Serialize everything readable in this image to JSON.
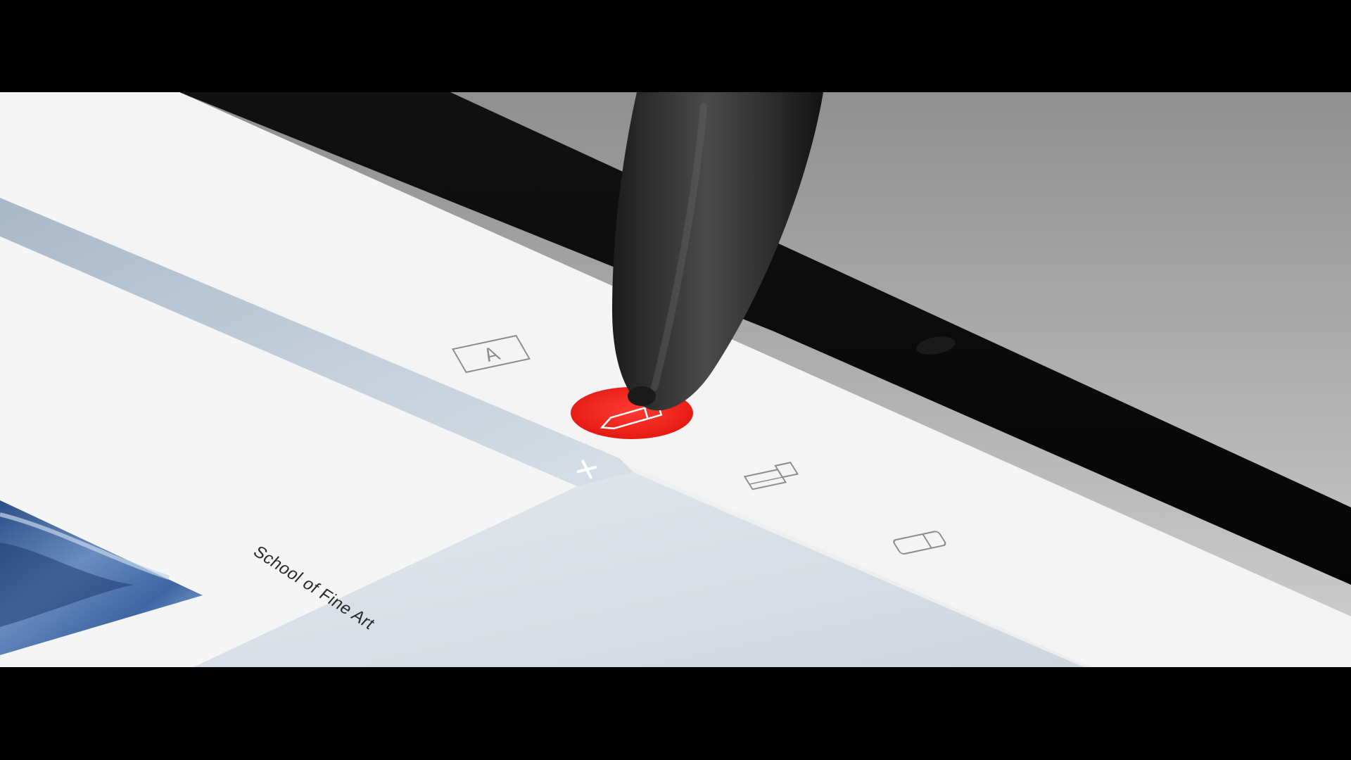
{
  "scene": {
    "caption": "School of Fine Art"
  },
  "icons": {
    "text_tool": "text-tool-icon",
    "pen_tool": "pen-tool-icon",
    "marker_tool": "marker-tool-icon",
    "eraser_tool": "eraser-tool-icon",
    "close": "close-icon"
  },
  "colors": {
    "active_tool": "#e8201e",
    "panel_header": "#b9c7d6",
    "screen": "#f1f2f3",
    "bezel": "#0d0d0d"
  }
}
